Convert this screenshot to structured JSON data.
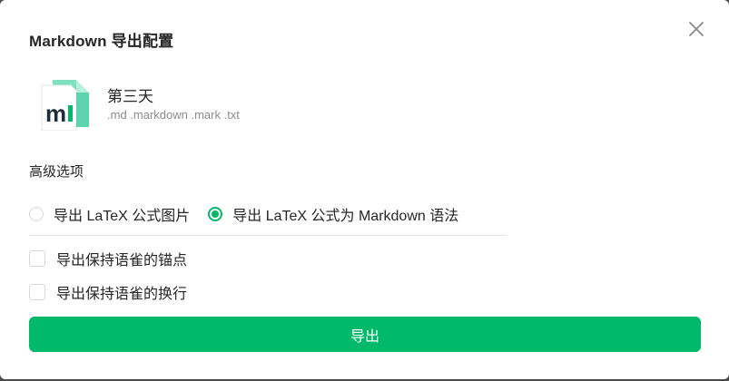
{
  "dialog": {
    "title": "Markdown 导出配置",
    "close_icon": "close-icon"
  },
  "file": {
    "icon": "markdown-file-icon",
    "icon_letter": "m",
    "name": "第三天",
    "extensions": ".md .markdown .mark .txt"
  },
  "advanced": {
    "title": "高级选项",
    "radio_options": [
      {
        "label": "导出 LaTeX 公式图片",
        "checked": false
      },
      {
        "label": "导出 LaTeX 公式为 Markdown 语法",
        "checked": true
      }
    ],
    "checkboxes": [
      {
        "label": "导出保持语雀的锚点",
        "checked": false
      },
      {
        "label": "导出保持语雀的换行",
        "checked": false
      }
    ]
  },
  "actions": {
    "export_label": "导出"
  },
  "colors": {
    "accent": "#00b96b",
    "text": "#262626",
    "muted": "#8c8c8c"
  }
}
